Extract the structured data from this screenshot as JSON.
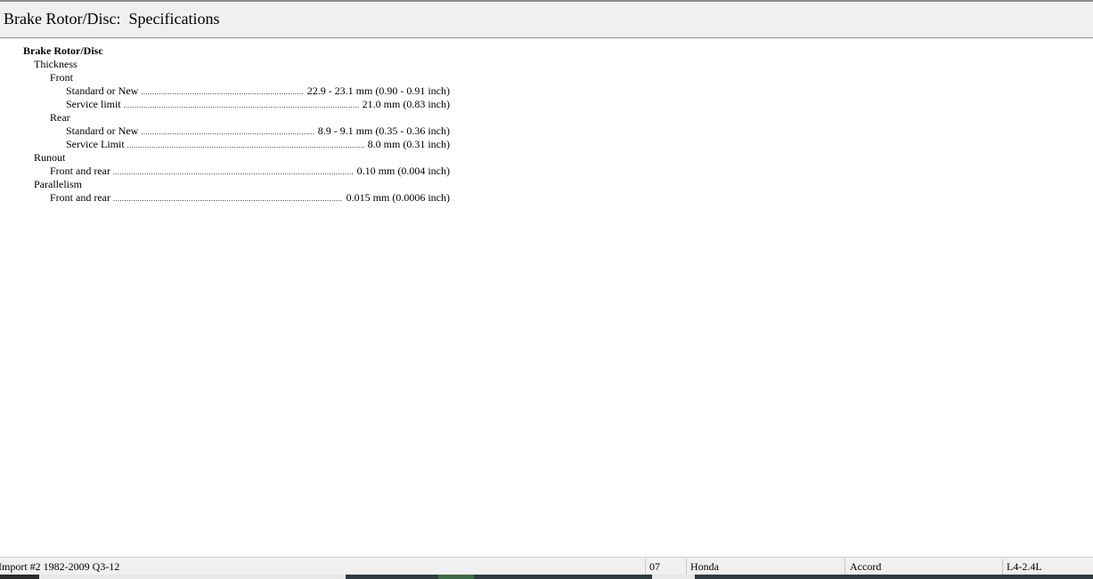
{
  "window": {
    "title": "Brake Rotor/Disc:  Specifications"
  },
  "spec": {
    "root": "Brake Rotor/Disc",
    "thickness": {
      "label": "Thickness",
      "front": {
        "label": "Front",
        "standard_label": "Standard or New",
        "standard_value": "22.9 - 23.1 mm (0.90 - 0.91 inch)",
        "service_label": "Service limit",
        "service_value": "21.0 mm (0.83 inch)"
      },
      "rear": {
        "label": "Rear",
        "standard_label": "Standard or New",
        "standard_value": "8.9 - 9.1 mm (0.35 - 0.36 inch)",
        "service_label": "Service Limit",
        "service_value": "8.0 mm (0.31 inch)"
      }
    },
    "runout": {
      "label": "Runout",
      "item_label": "Front and rear",
      "item_value": "0.10 mm (0.004 inch)"
    },
    "parallelism": {
      "label": "Parallelism",
      "item_label": "Front and rear",
      "item_value": "0.015 mm (0.0006 inch)"
    }
  },
  "status": {
    "database": "Import #2 1982-2009 Q3-12",
    "year": "07",
    "make": "Honda",
    "model": "Accord",
    "engine": "L4-2.4L"
  },
  "colors": {
    "chrome": "#f0f0f0",
    "border": "#8c8c8c"
  }
}
